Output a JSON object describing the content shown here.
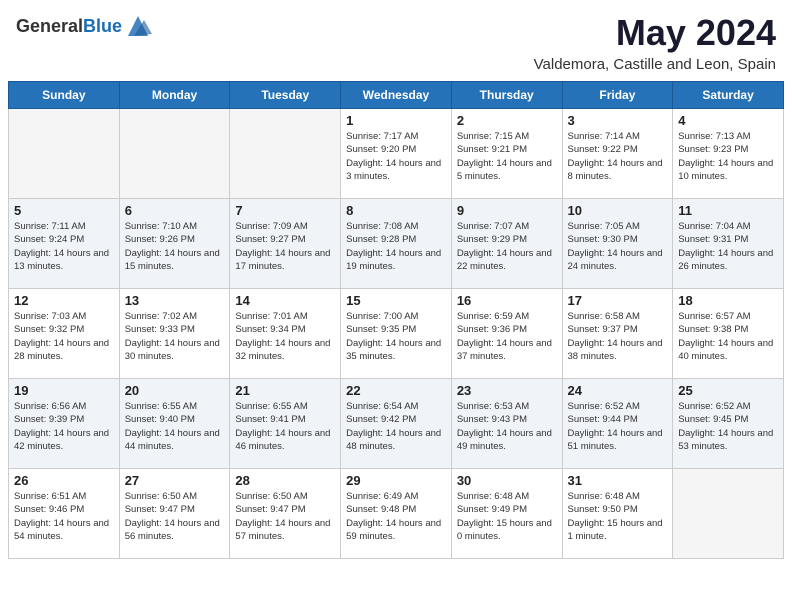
{
  "header": {
    "logo_general": "General",
    "logo_blue": "Blue",
    "title": "May 2024",
    "subtitle": "Valdemora, Castille and Leon, Spain"
  },
  "weekdays": [
    "Sunday",
    "Monday",
    "Tuesday",
    "Wednesday",
    "Thursday",
    "Friday",
    "Saturday"
  ],
  "weeks": [
    [
      {
        "day": "",
        "sunrise": "",
        "sunset": "",
        "daylight": ""
      },
      {
        "day": "",
        "sunrise": "",
        "sunset": "",
        "daylight": ""
      },
      {
        "day": "",
        "sunrise": "",
        "sunset": "",
        "daylight": ""
      },
      {
        "day": "1",
        "sunrise": "Sunrise: 7:17 AM",
        "sunset": "Sunset: 9:20 PM",
        "daylight": "Daylight: 14 hours and 3 minutes."
      },
      {
        "day": "2",
        "sunrise": "Sunrise: 7:15 AM",
        "sunset": "Sunset: 9:21 PM",
        "daylight": "Daylight: 14 hours and 5 minutes."
      },
      {
        "day": "3",
        "sunrise": "Sunrise: 7:14 AM",
        "sunset": "Sunset: 9:22 PM",
        "daylight": "Daylight: 14 hours and 8 minutes."
      },
      {
        "day": "4",
        "sunrise": "Sunrise: 7:13 AM",
        "sunset": "Sunset: 9:23 PM",
        "daylight": "Daylight: 14 hours and 10 minutes."
      }
    ],
    [
      {
        "day": "5",
        "sunrise": "Sunrise: 7:11 AM",
        "sunset": "Sunset: 9:24 PM",
        "daylight": "Daylight: 14 hours and 13 minutes."
      },
      {
        "day": "6",
        "sunrise": "Sunrise: 7:10 AM",
        "sunset": "Sunset: 9:26 PM",
        "daylight": "Daylight: 14 hours and 15 minutes."
      },
      {
        "day": "7",
        "sunrise": "Sunrise: 7:09 AM",
        "sunset": "Sunset: 9:27 PM",
        "daylight": "Daylight: 14 hours and 17 minutes."
      },
      {
        "day": "8",
        "sunrise": "Sunrise: 7:08 AM",
        "sunset": "Sunset: 9:28 PM",
        "daylight": "Daylight: 14 hours and 19 minutes."
      },
      {
        "day": "9",
        "sunrise": "Sunrise: 7:07 AM",
        "sunset": "Sunset: 9:29 PM",
        "daylight": "Daylight: 14 hours and 22 minutes."
      },
      {
        "day": "10",
        "sunrise": "Sunrise: 7:05 AM",
        "sunset": "Sunset: 9:30 PM",
        "daylight": "Daylight: 14 hours and 24 minutes."
      },
      {
        "day": "11",
        "sunrise": "Sunrise: 7:04 AM",
        "sunset": "Sunset: 9:31 PM",
        "daylight": "Daylight: 14 hours and 26 minutes."
      }
    ],
    [
      {
        "day": "12",
        "sunrise": "Sunrise: 7:03 AM",
        "sunset": "Sunset: 9:32 PM",
        "daylight": "Daylight: 14 hours and 28 minutes."
      },
      {
        "day": "13",
        "sunrise": "Sunrise: 7:02 AM",
        "sunset": "Sunset: 9:33 PM",
        "daylight": "Daylight: 14 hours and 30 minutes."
      },
      {
        "day": "14",
        "sunrise": "Sunrise: 7:01 AM",
        "sunset": "Sunset: 9:34 PM",
        "daylight": "Daylight: 14 hours and 32 minutes."
      },
      {
        "day": "15",
        "sunrise": "Sunrise: 7:00 AM",
        "sunset": "Sunset: 9:35 PM",
        "daylight": "Daylight: 14 hours and 35 minutes."
      },
      {
        "day": "16",
        "sunrise": "Sunrise: 6:59 AM",
        "sunset": "Sunset: 9:36 PM",
        "daylight": "Daylight: 14 hours and 37 minutes."
      },
      {
        "day": "17",
        "sunrise": "Sunrise: 6:58 AM",
        "sunset": "Sunset: 9:37 PM",
        "daylight": "Daylight: 14 hours and 38 minutes."
      },
      {
        "day": "18",
        "sunrise": "Sunrise: 6:57 AM",
        "sunset": "Sunset: 9:38 PM",
        "daylight": "Daylight: 14 hours and 40 minutes."
      }
    ],
    [
      {
        "day": "19",
        "sunrise": "Sunrise: 6:56 AM",
        "sunset": "Sunset: 9:39 PM",
        "daylight": "Daylight: 14 hours and 42 minutes."
      },
      {
        "day": "20",
        "sunrise": "Sunrise: 6:55 AM",
        "sunset": "Sunset: 9:40 PM",
        "daylight": "Daylight: 14 hours and 44 minutes."
      },
      {
        "day": "21",
        "sunrise": "Sunrise: 6:55 AM",
        "sunset": "Sunset: 9:41 PM",
        "daylight": "Daylight: 14 hours and 46 minutes."
      },
      {
        "day": "22",
        "sunrise": "Sunrise: 6:54 AM",
        "sunset": "Sunset: 9:42 PM",
        "daylight": "Daylight: 14 hours and 48 minutes."
      },
      {
        "day": "23",
        "sunrise": "Sunrise: 6:53 AM",
        "sunset": "Sunset: 9:43 PM",
        "daylight": "Daylight: 14 hours and 49 minutes."
      },
      {
        "day": "24",
        "sunrise": "Sunrise: 6:52 AM",
        "sunset": "Sunset: 9:44 PM",
        "daylight": "Daylight: 14 hours and 51 minutes."
      },
      {
        "day": "25",
        "sunrise": "Sunrise: 6:52 AM",
        "sunset": "Sunset: 9:45 PM",
        "daylight": "Daylight: 14 hours and 53 minutes."
      }
    ],
    [
      {
        "day": "26",
        "sunrise": "Sunrise: 6:51 AM",
        "sunset": "Sunset: 9:46 PM",
        "daylight": "Daylight: 14 hours and 54 minutes."
      },
      {
        "day": "27",
        "sunrise": "Sunrise: 6:50 AM",
        "sunset": "Sunset: 9:47 PM",
        "daylight": "Daylight: 14 hours and 56 minutes."
      },
      {
        "day": "28",
        "sunrise": "Sunrise: 6:50 AM",
        "sunset": "Sunset: 9:47 PM",
        "daylight": "Daylight: 14 hours and 57 minutes."
      },
      {
        "day": "29",
        "sunrise": "Sunrise: 6:49 AM",
        "sunset": "Sunset: 9:48 PM",
        "daylight": "Daylight: 14 hours and 59 minutes."
      },
      {
        "day": "30",
        "sunrise": "Sunrise: 6:48 AM",
        "sunset": "Sunset: 9:49 PM",
        "daylight": "Daylight: 15 hours and 0 minutes."
      },
      {
        "day": "31",
        "sunrise": "Sunrise: 6:48 AM",
        "sunset": "Sunset: 9:50 PM",
        "daylight": "Daylight: 15 hours and 1 minute."
      },
      {
        "day": "",
        "sunrise": "",
        "sunset": "",
        "daylight": ""
      }
    ]
  ]
}
